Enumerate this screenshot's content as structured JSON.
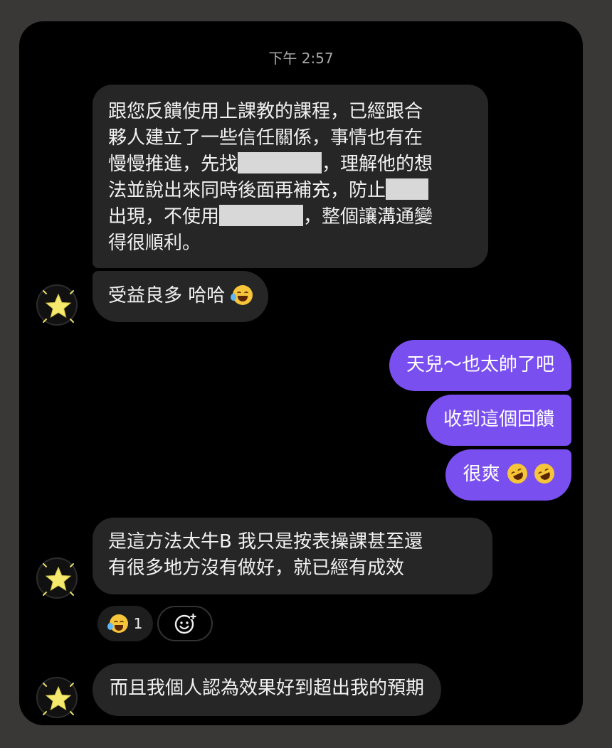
{
  "chat": {
    "timestamp": "下午 2:57",
    "messages": [
      {
        "lines": [
          "跟您反饋使用上課教的課程，已經跟合",
          "夥人建立了一些信任關係，事情也有在",
          "慢慢推進，先找",
          "，理解他的想",
          "法並說出來同時後面再補充，防止",
          "出現，不使用",
          "，整個讓溝通變",
          "得很順利。"
        ]
      },
      {
        "text": "受益良多 哈哈",
        "emoji": "face-with-tears-of-joy"
      },
      {
        "text": "天兒～也太帥了吧"
      },
      {
        "text": "收到這個回饋"
      },
      {
        "text": "很爽",
        "emoji": "rolling-on-the-floor-laughing"
      },
      {
        "lines": [
          "是這方法太牛B 我只是按表操課甚至還",
          "有很多地方沒有做好，就已經有成效"
        ]
      },
      {
        "text": "而且我個人認為效果好到超出我的預期"
      }
    ],
    "reaction": {
      "emoji": "face-with-tears-of-joy",
      "count": "1"
    },
    "add_reaction_icon": "add-reaction-icon",
    "avatar_icon": "star-icon"
  }
}
